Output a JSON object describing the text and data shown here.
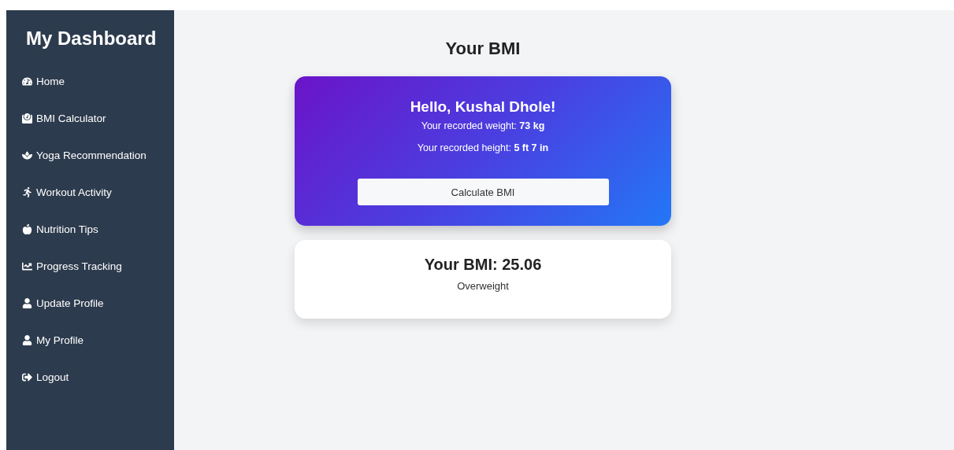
{
  "sidebar": {
    "title": "My Dashboard",
    "items": [
      {
        "label": "Home"
      },
      {
        "label": "BMI Calculator"
      },
      {
        "label": "Yoga Recommendation"
      },
      {
        "label": "Workout Activity"
      },
      {
        "label": "Nutrition Tips"
      },
      {
        "label": "Progress Tracking"
      },
      {
        "label": "Update Profile"
      },
      {
        "label": "My Profile"
      },
      {
        "label": "Logout"
      }
    ]
  },
  "page_title": "Your BMI",
  "greeting_card": {
    "greeting": "Hello, Kushal Dhole!",
    "weight": "Your recorded weight: **73 kg**",
    "height": "Your recorded height: **5 ft 7 in**",
    "button": "Calculate BMI"
  },
  "result_card": {
    "bmi": "Your BMI: 25.06",
    "category": "Overweight"
  }
}
